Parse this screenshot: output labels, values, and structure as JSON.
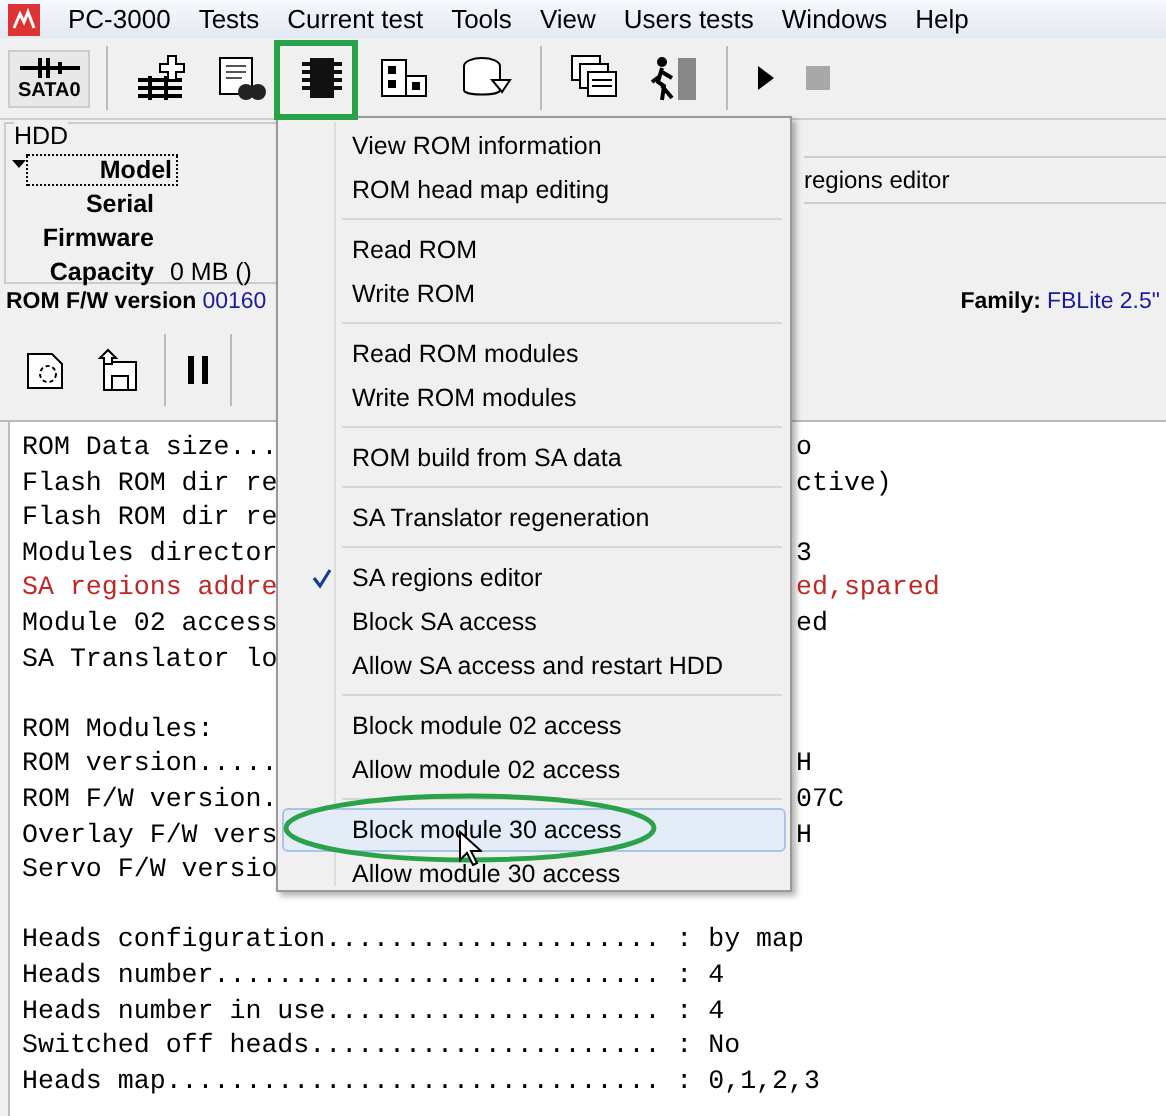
{
  "menubar": {
    "items": [
      "PC-3000",
      "Tests",
      "Current test",
      "Tools",
      "View",
      "Users tests",
      "Windows",
      "Help"
    ]
  },
  "toolbar": {
    "port_label": "SATA0"
  },
  "hdd": {
    "title": "HDD",
    "fields": [
      {
        "label": "Model",
        "focused": true
      },
      {
        "label": "Serial",
        "focused": false
      },
      {
        "label": "Firmware",
        "focused": false
      },
      {
        "label": "Capacity",
        "value": "0 MB ()",
        "focused": false
      }
    ],
    "side_title": "regions editor"
  },
  "info": {
    "fw_label": "ROM F/W version",
    "fw_value": "00160",
    "family_label": "Family:",
    "family_value": "FBLite 2.5\""
  },
  "log": [
    {
      "text": "ROM Data size...",
      "tail": "o",
      "kind": "normal"
    },
    {
      "text": "Flash ROM dir re",
      "tail": "ctive)",
      "kind": "normal"
    },
    {
      "text": "Flash ROM dir re",
      "kind": "normal"
    },
    {
      "text": "Modules director",
      "tail": "3",
      "kind": "normal"
    },
    {
      "text": "SA regions addre",
      "tail": "ed,spared",
      "kind": "error"
    },
    {
      "text": "Module 02 access",
      "tail": "ed",
      "kind": "normal"
    },
    {
      "text": "SA Translator lo",
      "kind": "normal"
    },
    {
      "kind": "blank"
    },
    {
      "text": "ROM Modules:",
      "kind": "normal"
    },
    {
      "text": "ROM version.....",
      "tail": "H",
      "kind": "normal"
    },
    {
      "text": "ROM F/W version.",
      "tail": "07C",
      "kind": "normal"
    },
    {
      "text": "Overlay F/W vers",
      "tail": "H",
      "kind": "normal"
    },
    {
      "text": "Servo F/W versio",
      "kind": "normal"
    },
    {
      "kind": "blank"
    },
    {
      "text": "Heads configuration..................... : by map",
      "kind": "normal"
    },
    {
      "text": "Heads number............................ : 4",
      "kind": "normal"
    },
    {
      "text": "Heads number in use..................... : 4",
      "kind": "normal"
    },
    {
      "text": "Switched off heads...................... : No",
      "kind": "normal"
    },
    {
      "text": "Heads map............................... : 0,1,2,3",
      "kind": "normal"
    }
  ],
  "menu": {
    "groups": [
      [
        {
          "label": "View ROM information",
          "checked": false,
          "highlighted": false
        },
        {
          "label": "ROM head map editing",
          "checked": false,
          "highlighted": false
        }
      ],
      [
        {
          "label": "Read ROM",
          "checked": false,
          "highlighted": false
        },
        {
          "label": "Write ROM",
          "checked": false,
          "highlighted": false
        }
      ],
      [
        {
          "label": "Read ROM modules",
          "checked": false,
          "highlighted": false
        },
        {
          "label": "Write ROM modules",
          "checked": false,
          "highlighted": false
        }
      ],
      [
        {
          "label": "ROM build from SA data",
          "checked": false,
          "highlighted": false
        }
      ],
      [
        {
          "label": "SA Translator regeneration",
          "checked": false,
          "highlighted": false
        }
      ],
      [
        {
          "label": "SA regions editor",
          "checked": true,
          "highlighted": false
        },
        {
          "label": "Block SA access",
          "checked": false,
          "highlighted": false
        },
        {
          "label": "Allow SA access and restart HDD",
          "checked": false,
          "highlighted": false
        }
      ],
      [
        {
          "label": "Block module 02 access",
          "checked": false,
          "highlighted": false
        },
        {
          "label": "Allow module 02 access",
          "checked": false,
          "highlighted": false
        }
      ],
      [
        {
          "label": "Block module 30 access",
          "checked": false,
          "highlighted": true
        },
        {
          "label": "Allow module 30 access",
          "checked": false,
          "highlighted": false
        }
      ]
    ]
  }
}
